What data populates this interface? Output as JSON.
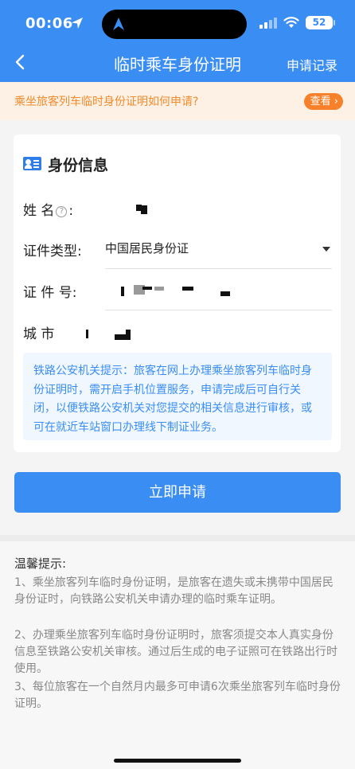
{
  "status_bar": {
    "time": "00:06",
    "battery": "52"
  },
  "nav": {
    "title": "临时乘车身份证明",
    "right_link": "申请记录"
  },
  "banner": {
    "text": "乘坐旅客列车临时身份证明如何申请?",
    "button": "查看"
  },
  "form": {
    "section_title": "身份信息",
    "name_label": "姓  名",
    "name_label_suffix": ":",
    "id_type_label": "证件类型:",
    "id_type_value": "中国居民身份证",
    "id_number_label": "证 件 号:",
    "city_label": "城      市"
  },
  "tip": "铁路公安机关提示：旅客在网上办理乘坐旅客列车临时身份证明时，需开启手机位置服务，申请完成后可自行关闭，以便铁路公安机关对您提交的相关信息进行审核，或可在就近车站窗口办理线下制证业务。",
  "submit_label": "立即申请",
  "notes": {
    "title": "温馨提示:",
    "items": [
      "1、乘坐旅客列车临时身份证明，是旅客在遗失或未携带中国居民身份证时，向铁路公安机关申请办理的临时乘车证明。",
      "2、办理乘坐旅客列车临时身份证明时，旅客须提交本人真实身份信息至铁路公安机关审核。通过后生成的电子证照可在铁路出行时使用。",
      "3、每位旅客在一个自然月内最多可申请6次乘坐旅客列车临时身份证明。"
    ]
  },
  "colors": {
    "primary": "#3a8ef3",
    "banner_bg": "#fdf1e6",
    "banner_text": "#f28b2b",
    "banner_button": "#f7812b"
  },
  "icons": [
    "location-arrow-icon",
    "app-icon",
    "signal-icon",
    "wifi-icon",
    "battery-icon",
    "back-arrow-icon",
    "chevron-right-icon",
    "id-card-icon",
    "help-icon",
    "caret-down-icon"
  ]
}
